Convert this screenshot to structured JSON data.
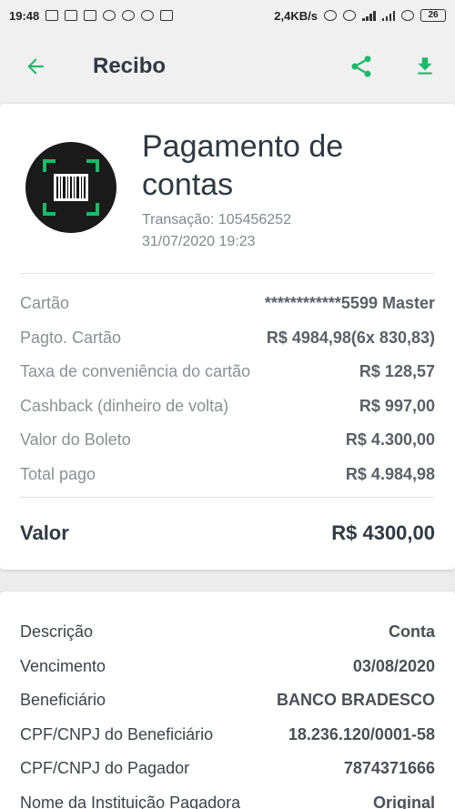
{
  "status_bar": {
    "time": "19:48",
    "network_speed": "2,4KB/s",
    "battery": "26"
  },
  "app_bar": {
    "title": "Recibo",
    "back_icon": "arrow-back-icon",
    "share_icon": "share-icon",
    "download_icon": "download-icon"
  },
  "colors": {
    "accent": "#1fb86a",
    "title": "#2f3a43"
  },
  "header": {
    "title": "Pagamento de contas",
    "transaction": "Transação: 105456252",
    "datetime": "31/07/2020 19:23",
    "logo_icon": "barcode-scan-icon"
  },
  "details": [
    {
      "label": "Cartão",
      "value": "************5599 Master"
    },
    {
      "label": "Pagto. Cartão",
      "value": "R$ 4984,98(6x 830,83)"
    },
    {
      "label": "Taxa de conveniência do cartão",
      "value": "R$ 128,57"
    },
    {
      "label": "Cashback (dinheiro de volta)",
      "value": "R$ 997,00"
    },
    {
      "label": "Valor do Boleto",
      "value": "R$ 4.300,00"
    },
    {
      "label": "Total pago",
      "value": "R$ 4.984,98"
    }
  ],
  "total": {
    "label": "Valor",
    "value": "R$ 4300,00"
  },
  "boleto": [
    {
      "label": "Descrição",
      "value": "Conta"
    },
    {
      "label": "Vencimento",
      "value": "03/08/2020"
    },
    {
      "label": "Beneficiário",
      "value": "BANCO BRADESCO"
    },
    {
      "label": "CPF/CNPJ do Beneficiário",
      "value": "18.236.120/0001-58"
    },
    {
      "label": "CPF/CNPJ do Pagador",
      "value": "7874371666"
    },
    {
      "label": "Nome da Instituição Pagadora",
      "value": "Original"
    }
  ]
}
